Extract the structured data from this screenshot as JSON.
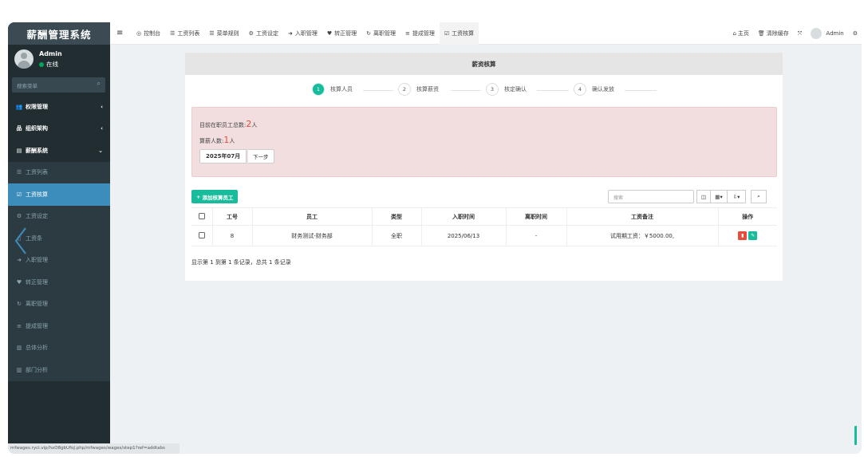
{
  "sidebar": {
    "brand": "薪酬管理系统",
    "user": {
      "name": "Admin",
      "status": "在线"
    },
    "search_placeholder": "搜索菜单",
    "items": [
      {
        "label": "权限管理",
        "icon": "users-icon",
        "glyph": "👥"
      },
      {
        "label": "组织架构",
        "icon": "sitemap-icon",
        "glyph": "品"
      },
      {
        "label": "薪酬系统",
        "icon": "list-icon",
        "glyph": "▤"
      },
      {
        "label": "工资列表",
        "icon": "list-icon",
        "glyph": "☰"
      },
      {
        "label": "工资核算",
        "icon": "check-square-icon",
        "glyph": "☑"
      },
      {
        "label": "工资设定",
        "icon": "gear-icon",
        "glyph": "⚙"
      },
      {
        "label": "工资条",
        "icon": "file-icon",
        "glyph": "▯"
      },
      {
        "label": "入职管理",
        "icon": "sign-in-icon",
        "glyph": "➜"
      },
      {
        "label": "转正管理",
        "icon": "heart-icon",
        "glyph": "♥"
      },
      {
        "label": "离职管理",
        "icon": "refresh-icon",
        "glyph": "↻"
      },
      {
        "label": "提成管理",
        "icon": "list-alt-icon",
        "glyph": "≡"
      },
      {
        "label": "总体分析",
        "icon": "bar-chart-icon",
        "glyph": "▥"
      },
      {
        "label": "部门分析",
        "icon": "bar-chart-icon",
        "glyph": "▥"
      }
    ]
  },
  "topbar": {
    "tabs": [
      {
        "label": "控制台",
        "glyph": "◎"
      },
      {
        "label": "工资列表",
        "glyph": "☰"
      },
      {
        "label": "菜单规则",
        "glyph": "☰"
      },
      {
        "label": "工资设定",
        "glyph": "⚙"
      },
      {
        "label": "入职管理",
        "glyph": "➜"
      },
      {
        "label": "转正管理",
        "glyph": "♥"
      },
      {
        "label": "离职管理",
        "glyph": "↻"
      },
      {
        "label": "提成管理",
        "glyph": "≡"
      },
      {
        "label": "工资核算",
        "glyph": "☑"
      }
    ],
    "home": "主页",
    "clear_cache": "清除缓存",
    "user": "Admin"
  },
  "panel": {
    "title": "薪资核算",
    "steps": [
      {
        "num": "1",
        "label": "核算人员"
      },
      {
        "num": "2",
        "label": "核算薪资"
      },
      {
        "num": "3",
        "label": "核定确认"
      },
      {
        "num": "4",
        "label": "确认发放"
      }
    ],
    "alert": {
      "line1_prefix": "目前在职员工总数:",
      "line1_count": "2",
      "line1_suffix": "人",
      "line2_prefix": "算薪人数:",
      "line2_count": "1",
      "line2_suffix": "人",
      "month": "2025年07月",
      "next": "下一步"
    },
    "add_button": "添加核算员工",
    "search_placeholder": "搜索",
    "table": {
      "headers": [
        "工号",
        "员工",
        "类型",
        "入职时间",
        "离职时间",
        "工资备注",
        "操作"
      ],
      "rows": [
        {
          "id": "8",
          "employee": "财务测试-财务部",
          "type": "全职",
          "joined": "2025/06/13",
          "left": "-",
          "note": "试用期工资：￥5000.00,"
        }
      ]
    },
    "pagination": "显示第 1 到第 1 条记录，总共 1 条记录"
  },
  "status_url": "mfwages.ryci.vip/hxO8gbUfoJ.php/mfwages/wages/step1?ref=addtabs",
  "colors": {
    "accent": "#18bc9c",
    "sidebar": "#222d32",
    "active": "#3c8dbc",
    "alert_bg": "#f2dede",
    "danger": "#e74c3c"
  }
}
